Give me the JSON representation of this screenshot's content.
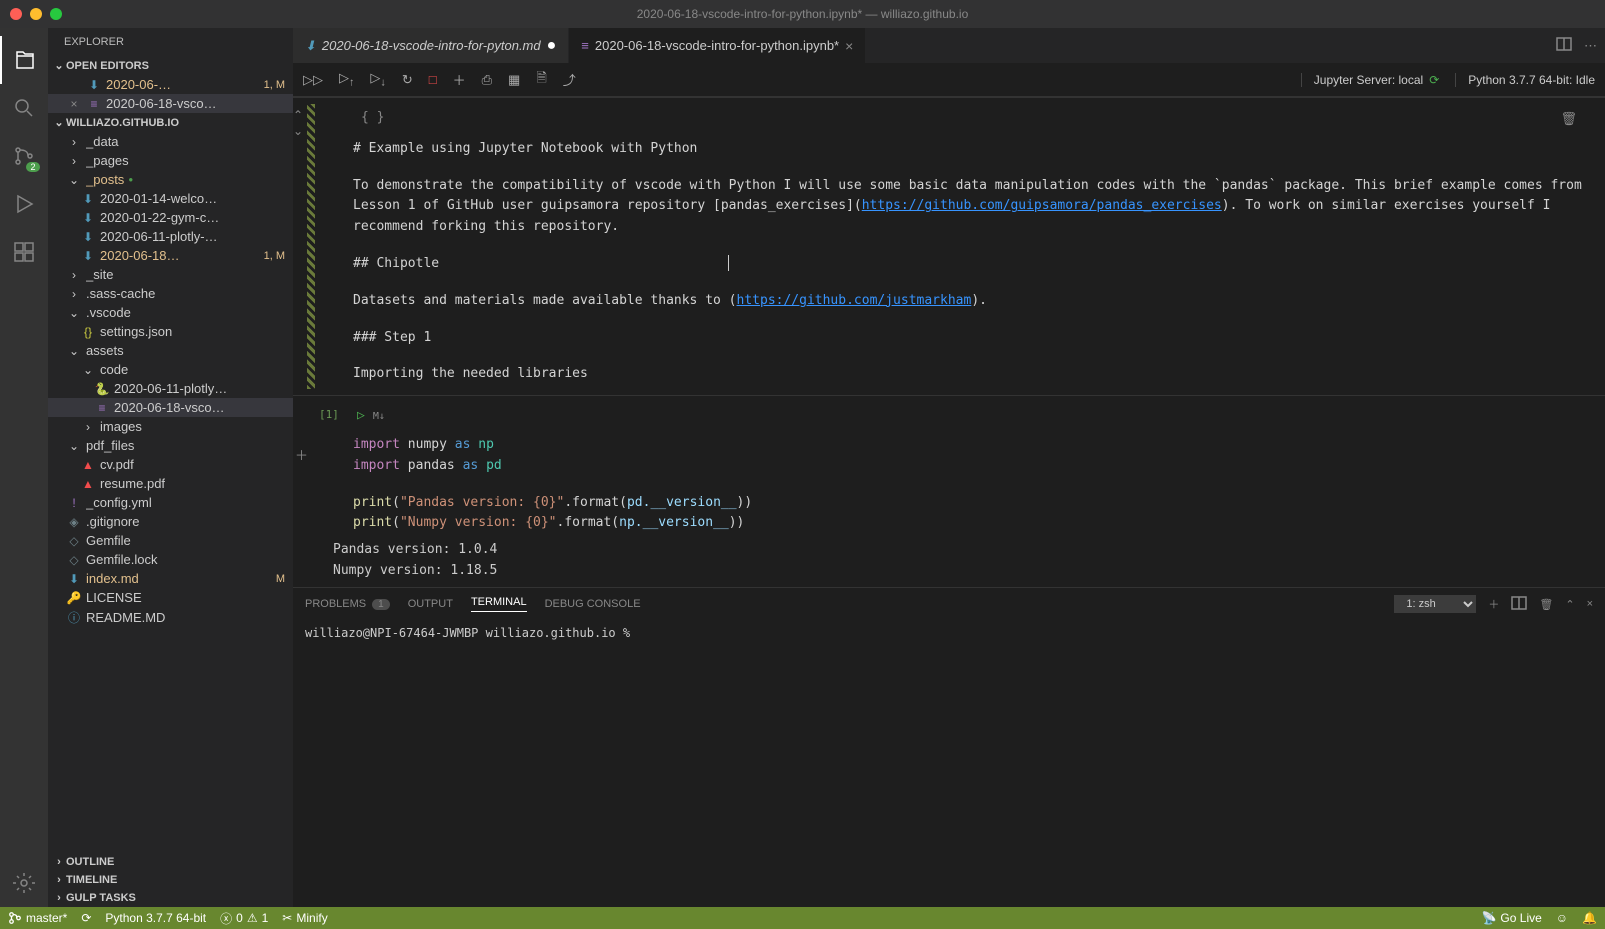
{
  "titlebar": {
    "title": "2020-06-18-vscode-intro-for-python.ipynb* — williazo.github.io"
  },
  "sidebar": {
    "title": "EXPLORER",
    "openEditors": {
      "label": "OPEN EDITORS"
    },
    "editors": [
      {
        "name": "2020-06-…",
        "badge": "1, M",
        "modified": true
      },
      {
        "name": "2020-06-18-vsco…",
        "closeable": true
      }
    ],
    "workspace": {
      "label": "WILLIAZO.GITHUB.IO"
    },
    "tree": [
      {
        "depth": 1,
        "type": "folder",
        "open": false,
        "label": "_data"
      },
      {
        "depth": 1,
        "type": "folder",
        "open": false,
        "label": "_pages"
      },
      {
        "depth": 1,
        "type": "folder",
        "open": true,
        "label": "_posts",
        "modified": true,
        "gitdot": true
      },
      {
        "depth": 2,
        "type": "file",
        "icon": "md",
        "label": "2020-01-14-welco…"
      },
      {
        "depth": 2,
        "type": "file",
        "icon": "md",
        "label": "2020-01-22-gym-c…"
      },
      {
        "depth": 2,
        "type": "file",
        "icon": "md",
        "label": "2020-06-11-plotly-…"
      },
      {
        "depth": 2,
        "type": "file",
        "icon": "md",
        "label": "2020-06-18…",
        "badge": "1, M",
        "modified": true
      },
      {
        "depth": 1,
        "type": "folder",
        "open": false,
        "label": "_site"
      },
      {
        "depth": 1,
        "type": "folder",
        "open": false,
        "label": ".sass-cache"
      },
      {
        "depth": 1,
        "type": "folder",
        "open": true,
        "label": ".vscode"
      },
      {
        "depth": 2,
        "type": "file",
        "icon": "json",
        "label": "settings.json"
      },
      {
        "depth": 1,
        "type": "folder",
        "open": true,
        "label": "assets"
      },
      {
        "depth": 2,
        "type": "folder",
        "open": true,
        "label": "code"
      },
      {
        "depth": 3,
        "type": "file",
        "icon": "py",
        "label": "2020-06-11-plotly…"
      },
      {
        "depth": 3,
        "type": "file",
        "icon": "nb",
        "label": "2020-06-18-vsco…",
        "selected": true
      },
      {
        "depth": 2,
        "type": "folder",
        "open": false,
        "label": "images"
      },
      {
        "depth": 1,
        "type": "folder",
        "open": true,
        "label": "pdf_files"
      },
      {
        "depth": 2,
        "type": "file",
        "icon": "pdf",
        "label": "cv.pdf"
      },
      {
        "depth": 2,
        "type": "file",
        "icon": "pdf",
        "label": "resume.pdf"
      },
      {
        "depth": 1,
        "type": "file",
        "icon": "yml",
        "label": "_config.yml"
      },
      {
        "depth": 1,
        "type": "file",
        "icon": "git",
        "label": ".gitignore"
      },
      {
        "depth": 1,
        "type": "file",
        "icon": "gem",
        "label": "Gemfile"
      },
      {
        "depth": 1,
        "type": "file",
        "icon": "gem",
        "label": "Gemfile.lock"
      },
      {
        "depth": 1,
        "type": "file",
        "icon": "md",
        "label": "index.md",
        "badge": "M",
        "modified": true
      },
      {
        "depth": 1,
        "type": "file",
        "icon": "lic",
        "label": "LICENSE"
      },
      {
        "depth": 1,
        "type": "file",
        "icon": "info",
        "label": "README.MD"
      }
    ],
    "outline": "OUTLINE",
    "timeline": "TIMELINE",
    "gulp": "GULP TASKS"
  },
  "tabs": [
    {
      "icon": "md",
      "label": "2020-06-18-vscode-intro-for-pyton.md",
      "active": false,
      "dirty": true
    },
    {
      "icon": "nb",
      "label": "2020-06-18-vscode-intro-for-python.ipynb*",
      "active": true,
      "close": true
    }
  ],
  "notebook": {
    "server": "Jupyter Server: local",
    "kernel": "Python 3.7.7 64-bit: Idle",
    "markdown": {
      "braces": "{ }",
      "h1": "# Example using Jupyter Notebook with Python",
      "p1a": "To demonstrate the compatibility of vscode with Python I will use some basic data manipulation codes with the `pandas` package. This brief example comes from Lesson 1 of GitHub user guipsamora repository [pandas_exercises](",
      "link1": "https://github.com/guipsamora/pandas_exercises",
      "p1b": "). To work on similar exercises yourself I recommend forking this repository.",
      "h2": "## Chipotle",
      "p2a": "Datasets and materials made available thanks to (",
      "link2": "https://github.com/justmarkham",
      "p2b": ").",
      "h3": "### Step 1",
      "p3": "Importing the needed libraries"
    },
    "code": {
      "prompt": "[1]",
      "mk": "M↓",
      "line1_import": "import",
      "line1_np": "numpy",
      "line1_as": "as",
      "line1_alias": "np",
      "line2_import": "import",
      "line2_pd": "pandas",
      "line2_as": "as",
      "line2_alias": "pd",
      "print1_fn": "print",
      "print1_str": "\"Pandas version: {0}\"",
      "format": ".format(",
      "pd": "pd",
      "ver": ".__version__",
      "close": "))",
      "print2_str": "\"Numpy version: {0}\"",
      "np": "np",
      "out1": "Pandas version: 1.0.4",
      "out2": "Numpy version: 1.18.5"
    }
  },
  "panel": {
    "problems": "PROBLEMS",
    "problemsCount": "1",
    "output": "OUTPUT",
    "terminal": "TERMINAL",
    "debug": "DEBUG CONSOLE",
    "termSelect": "1: zsh",
    "prompt": "williazo@NPI-67464-JWMBP williazo.github.io % "
  },
  "statusbar": {
    "branch": "master*",
    "python": "Python 3.7.7 64-bit",
    "errors": "0",
    "warnings": "1",
    "minify": "Minify",
    "golive": "Go Live"
  }
}
